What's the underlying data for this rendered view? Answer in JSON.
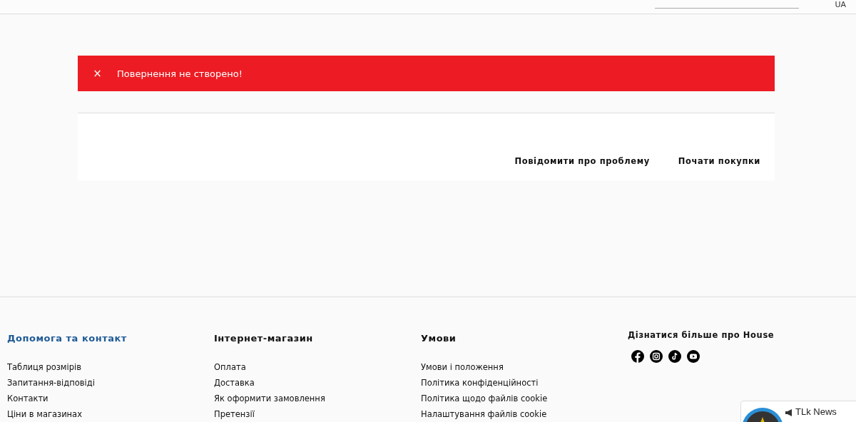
{
  "header": {
    "language": "UA"
  },
  "alert": {
    "icon": "×",
    "message": "Повернення не створено!"
  },
  "actions": [
    "Повідомити про проблему",
    "Почати покупки"
  ],
  "footer": {
    "columns": [
      {
        "title": "Допомога та контакт",
        "active": true,
        "links": [
          "Таблиця розмірів",
          "Запитання-відповіді",
          "Контакти",
          "Ціни в магазинах"
        ]
      },
      {
        "title": "Інтернет-магазин",
        "active": false,
        "links": [
          "Оплата",
          "Доставка",
          "Як оформити замовлення",
          "Претензії"
        ]
      },
      {
        "title": "Умови",
        "active": false,
        "links": [
          "Умови і положення",
          "Політика конфіденційності",
          "Політика щодо файлів cookie",
          "Налаштування файлів cookie"
        ]
      }
    ],
    "social": {
      "title": "Дізнатися більше про House"
    }
  },
  "widget": {
    "title": "TLk News"
  }
}
